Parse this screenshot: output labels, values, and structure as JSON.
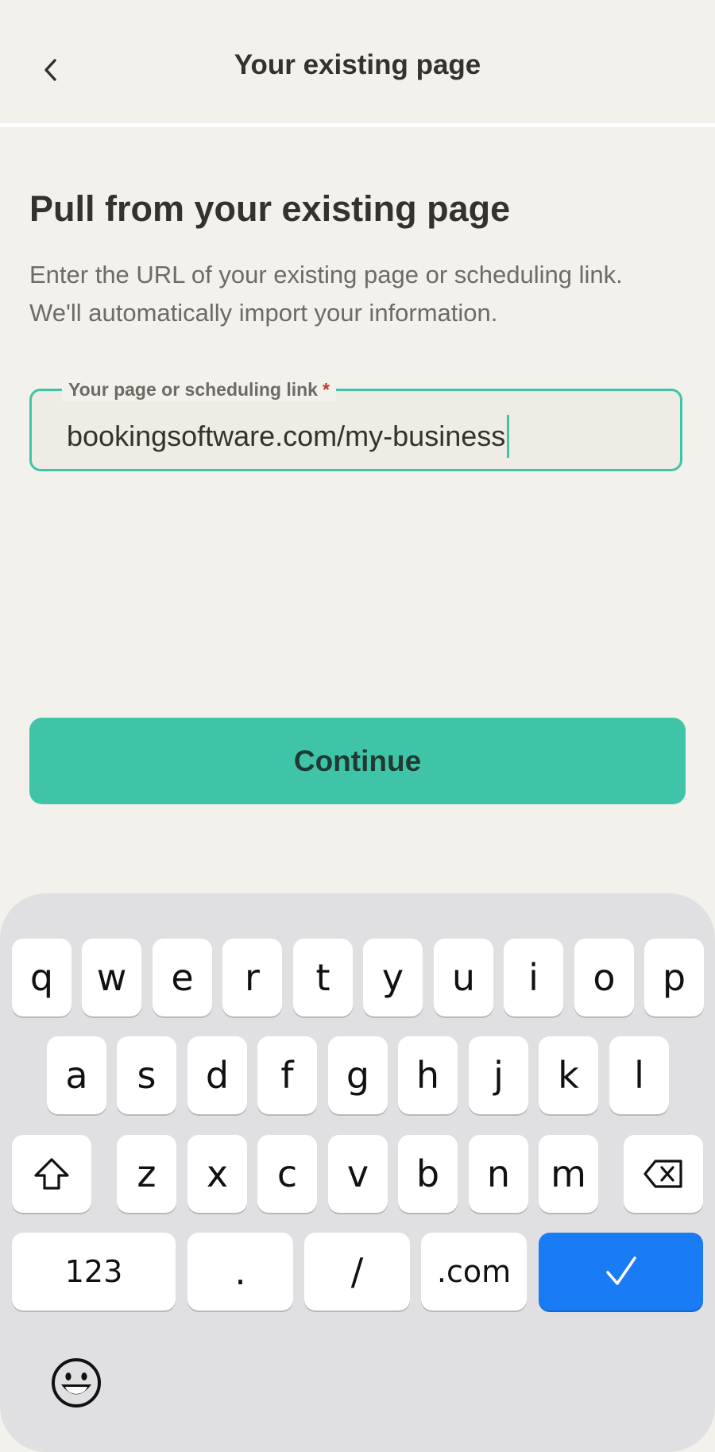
{
  "header": {
    "title": "Your existing page",
    "back_icon": "chevron-left-icon"
  },
  "main": {
    "heading": "Pull from your existing page",
    "subtitle_line1": "Enter the URL of your existing page or scheduling link.",
    "subtitle_line2": "We'll automatically import your information.",
    "field": {
      "label": "Your page or scheduling link",
      "required_marker": "*",
      "value": "bookingsoftware.com/my-business"
    },
    "continue_label": "Continue"
  },
  "keyboard": {
    "row1": [
      "q",
      "w",
      "e",
      "r",
      "t",
      "y",
      "u",
      "i",
      "o",
      "p"
    ],
    "row2": [
      "a",
      "s",
      "d",
      "f",
      "g",
      "h",
      "j",
      "k",
      "l"
    ],
    "row3": [
      "z",
      "x",
      "c",
      "v",
      "b",
      "n",
      "m"
    ],
    "shift_icon": "shift-icon",
    "backspace_icon": "backspace-icon",
    "numbers_label": "123",
    "period_label": ".",
    "slash_label": "/",
    "dotcom_label": ".com",
    "done_icon": "checkmark-icon",
    "emoji_icon": "emoji-icon"
  },
  "colors": {
    "background": "#f3f1ec",
    "accent": "#40c4a7",
    "keyboard_background": "#e0e0e2",
    "done_key": "#1a7cf5",
    "text_primary": "#35322d",
    "text_secondary": "#6e6a64"
  }
}
